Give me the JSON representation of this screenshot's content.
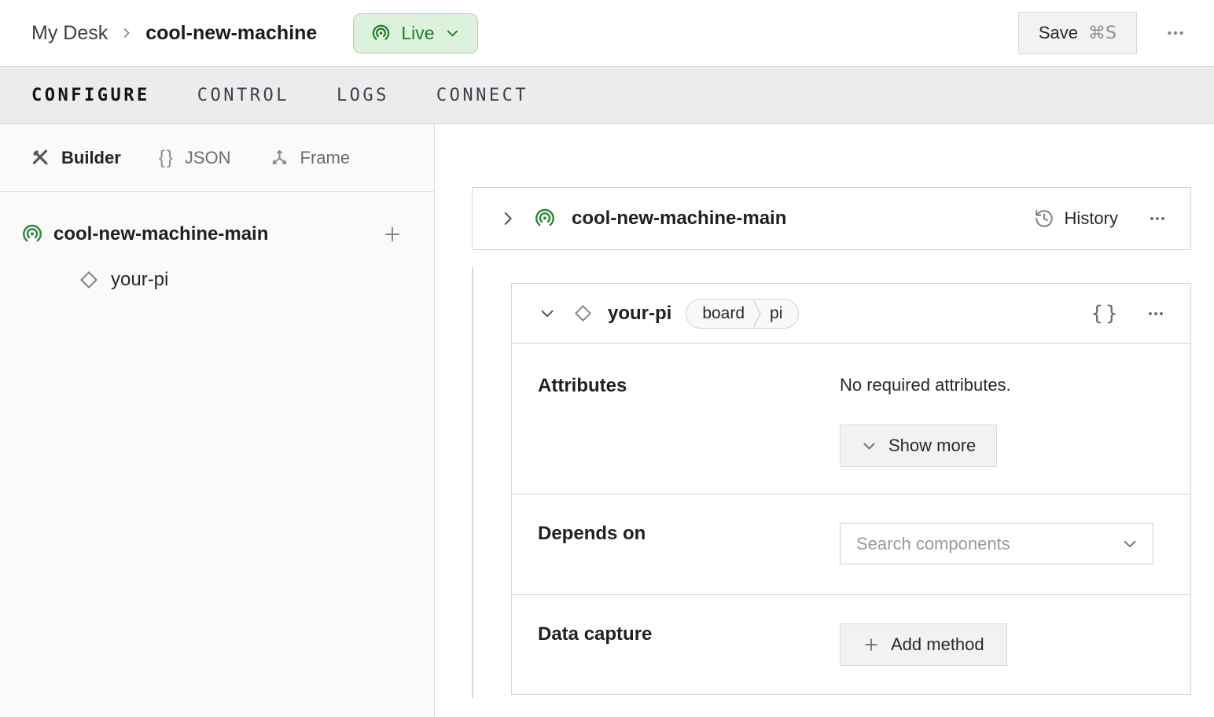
{
  "topbar": {
    "breadcrumb": {
      "parent": "My Desk",
      "current": "cool-new-machine"
    },
    "live_status": {
      "label": "Live"
    },
    "save_button": {
      "label": "Save",
      "shortcut": "⌘S"
    }
  },
  "tabs": [
    {
      "label": "CONFIGURE",
      "active": true
    },
    {
      "label": "CONTROL",
      "active": false
    },
    {
      "label": "LOGS",
      "active": false
    },
    {
      "label": "CONNECT",
      "active": false
    }
  ],
  "sidebar": {
    "modes": [
      {
        "label": "Builder",
        "icon": "tools-icon",
        "active": true
      },
      {
        "label": "JSON",
        "icon": "braces-icon",
        "active": false
      },
      {
        "label": "Frame",
        "icon": "frame-icon",
        "active": false
      }
    ],
    "tree": {
      "root": {
        "label": "cool-new-machine-main",
        "icon": "machine-part-icon"
      },
      "children": [
        {
          "label": "your-pi",
          "icon": "diamond-icon"
        }
      ]
    }
  },
  "main": {
    "part_card": {
      "title": "cool-new-machine-main",
      "history_label": "History"
    },
    "component_card": {
      "title": "your-pi",
      "type_badge": {
        "type": "board",
        "model": "pi"
      },
      "attributes": {
        "label": "Attributes",
        "empty_text": "No required attributes.",
        "show_more_label": "Show more"
      },
      "depends_on": {
        "label": "Depends on",
        "search_placeholder": "Search components"
      },
      "data_capture": {
        "label": "Data capture",
        "add_method_label": "Add method"
      }
    }
  },
  "icons": {
    "braces_glyph": "{}"
  },
  "colors": {
    "live_bg": "#ddf2dd",
    "live_border": "#a6d7a6",
    "live_text": "#1d7a28",
    "brand_green": "#2b8a3a",
    "tab_bar_bg": "#ececee",
    "card_border": "#d5d5d7",
    "button_bg": "#f2f2f3",
    "button_border": "#d9d9da",
    "placeholder_text": "#989aa4"
  }
}
